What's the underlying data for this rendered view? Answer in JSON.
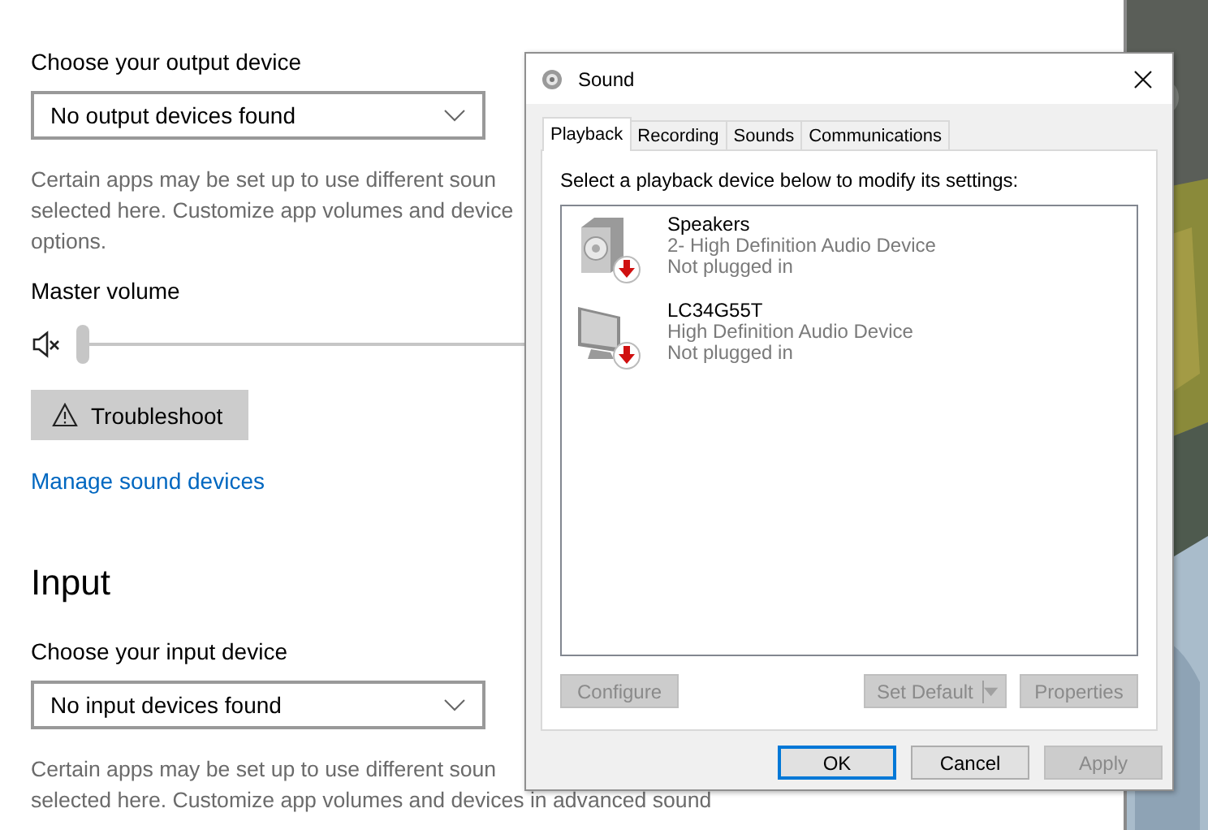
{
  "output": {
    "device_label": "Choose your output device",
    "dropdown": {
      "value": "No output devices found"
    },
    "note_lines": [
      "Certain apps may be set up to use different soun",
      "selected here. Customize app volumes and device",
      "options."
    ],
    "volume_label": "Master volume",
    "volume": {
      "muted": true,
      "level": 0
    },
    "troubleshoot": "Troubleshoot",
    "link": "Manage sound devices"
  },
  "input": {
    "heading": "Input",
    "device_label": "Choose your input device",
    "dropdown": {
      "value": "No input devices found"
    },
    "note_lines": [
      "Certain apps may be set up to use different soun",
      "selected here. Customize app volumes and devices in advanced sound"
    ]
  },
  "dialog": {
    "title": "Sound",
    "tabs": [
      {
        "label": "Playback",
        "selected": true
      },
      {
        "label": "Recording",
        "selected": false
      },
      {
        "label": "Sounds",
        "selected": false
      },
      {
        "label": "Communications",
        "selected": false
      }
    ],
    "instruction": "Select a playback device below to modify its settings:",
    "devices": [
      {
        "kind": "speaker",
        "name": "Speakers",
        "description": "2- High Definition Audio Device",
        "status": "Not plugged in"
      },
      {
        "kind": "monitor",
        "name": "LC34G55T",
        "description": "High Definition Audio Device",
        "status": "Not plugged in"
      }
    ],
    "device_buttons": [
      {
        "kind": "plain",
        "label": "Configure",
        "disabled": true
      },
      {
        "kind": "split",
        "label": "Set Default",
        "disabled": true
      },
      {
        "kind": "plain",
        "label": "Properties",
        "disabled": true
      }
    ],
    "footer_buttons": [
      {
        "label": "OK",
        "default": true,
        "disabled": false
      },
      {
        "label": "Cancel",
        "default": false,
        "disabled": false
      },
      {
        "label": "Apply",
        "default": false,
        "disabled": true
      }
    ]
  }
}
